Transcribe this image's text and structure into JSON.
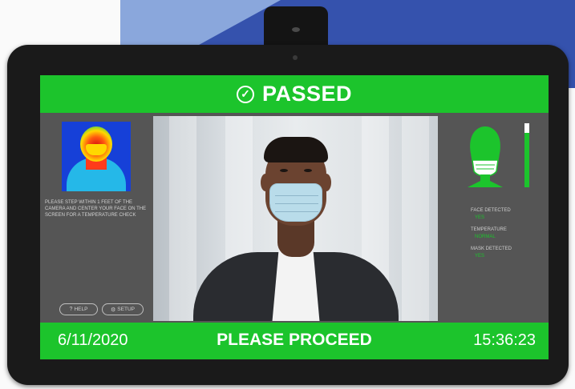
{
  "status": {
    "label": "PASSED",
    "color": "#1cc42c"
  },
  "instructions": "PLEASE STEP WITHIN 1 FEET OF THE CAMERA AND CENTER YOUR FACE ON THE SCREEN FOR A TEMPERATURE CHECK",
  "buttons": {
    "help": "HELP",
    "setup": "SETUP"
  },
  "readouts": [
    {
      "label": "FACE DETECTED",
      "value": "YES"
    },
    {
      "label": "TEMPERATURE",
      "value": "NORMAL"
    },
    {
      "label": "MASK DETECTED",
      "value": "YES"
    }
  ],
  "footer": {
    "date": "6/11/2020",
    "message": "PLEASE PROCEED",
    "time": "15:36:23"
  },
  "icons": {
    "status": "check-circle-icon",
    "help": "help-icon",
    "setup": "gear-icon",
    "mask": "face-mask-icon",
    "gauge": "temperature-gauge-icon"
  }
}
